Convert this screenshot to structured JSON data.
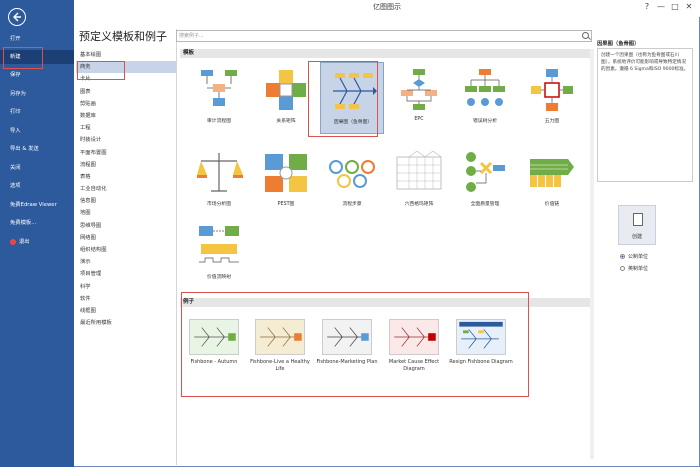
{
  "window": {
    "title": "亿图图示",
    "help": "?",
    "minimize": "—",
    "maximize": "□",
    "close": "✕"
  },
  "left_menu": [
    {
      "label": "打开"
    },
    {
      "label": "新建",
      "active": true
    },
    {
      "label": "保存"
    },
    {
      "label": "另存为"
    },
    {
      "label": "打印"
    },
    {
      "label": "导入"
    },
    {
      "label": "导出 & 发送"
    },
    {
      "label": "关闭"
    },
    {
      "label": "选项"
    },
    {
      "label": "免费Edraw Viewer"
    },
    {
      "label": "免费模板..."
    },
    {
      "label": "退出"
    }
  ],
  "heading": "预定义模板和例子",
  "categories": [
    "基本绘图",
    "商务",
    "卡片",
    "图表",
    "剪贴画",
    "数据库",
    "工程",
    "时装设计",
    "平面布置图",
    "流程图",
    "表格",
    "工业自动化",
    "信息图",
    "地图",
    "思维导图",
    "网络图",
    "组织结构图",
    "演示",
    "项目管理",
    "科学",
    "软件",
    "线框图",
    "最近所用模板"
  ],
  "selected_category": "商务",
  "search": {
    "placeholder": "搜索例子..."
  },
  "templates_header": "模板",
  "templates": [
    {
      "label": "审计流程图"
    },
    {
      "label": "关系矩阵"
    },
    {
      "label": "因果图（鱼骨图）",
      "selected": true
    },
    {
      "label": "EPC"
    },
    {
      "label": "错误树分析"
    },
    {
      "label": "五力图"
    },
    {
      "label": "市场分析图"
    },
    {
      "label": "PEST图"
    },
    {
      "label": "流程步骤"
    },
    {
      "label": "六西格玛矩阵"
    },
    {
      "label": "全面质量管理"
    },
    {
      "label": "价值链"
    },
    {
      "label": "价值流映射"
    }
  ],
  "examples_header": "例子",
  "examples": [
    {
      "label": "Fishbone - Autumn"
    },
    {
      "label": "Fishbone-Live a Healthy Life"
    },
    {
      "label": "Fishbone-Marketing Plan"
    },
    {
      "label": "Market Cause Effect Diagram"
    },
    {
      "label": "Resign Fishbone Diagram"
    }
  ],
  "right_panel": {
    "title": "因果图（鱼骨图）",
    "description": "创建一个因果图（也称为鱼骨图或石川图），系统地评价可能影响或导致特定情况的因素。遵循 6 Sigma和ISO 9000标准。",
    "create_label": "创建",
    "unit_metric": "公制单位",
    "unit_imperial": "英制单位"
  }
}
